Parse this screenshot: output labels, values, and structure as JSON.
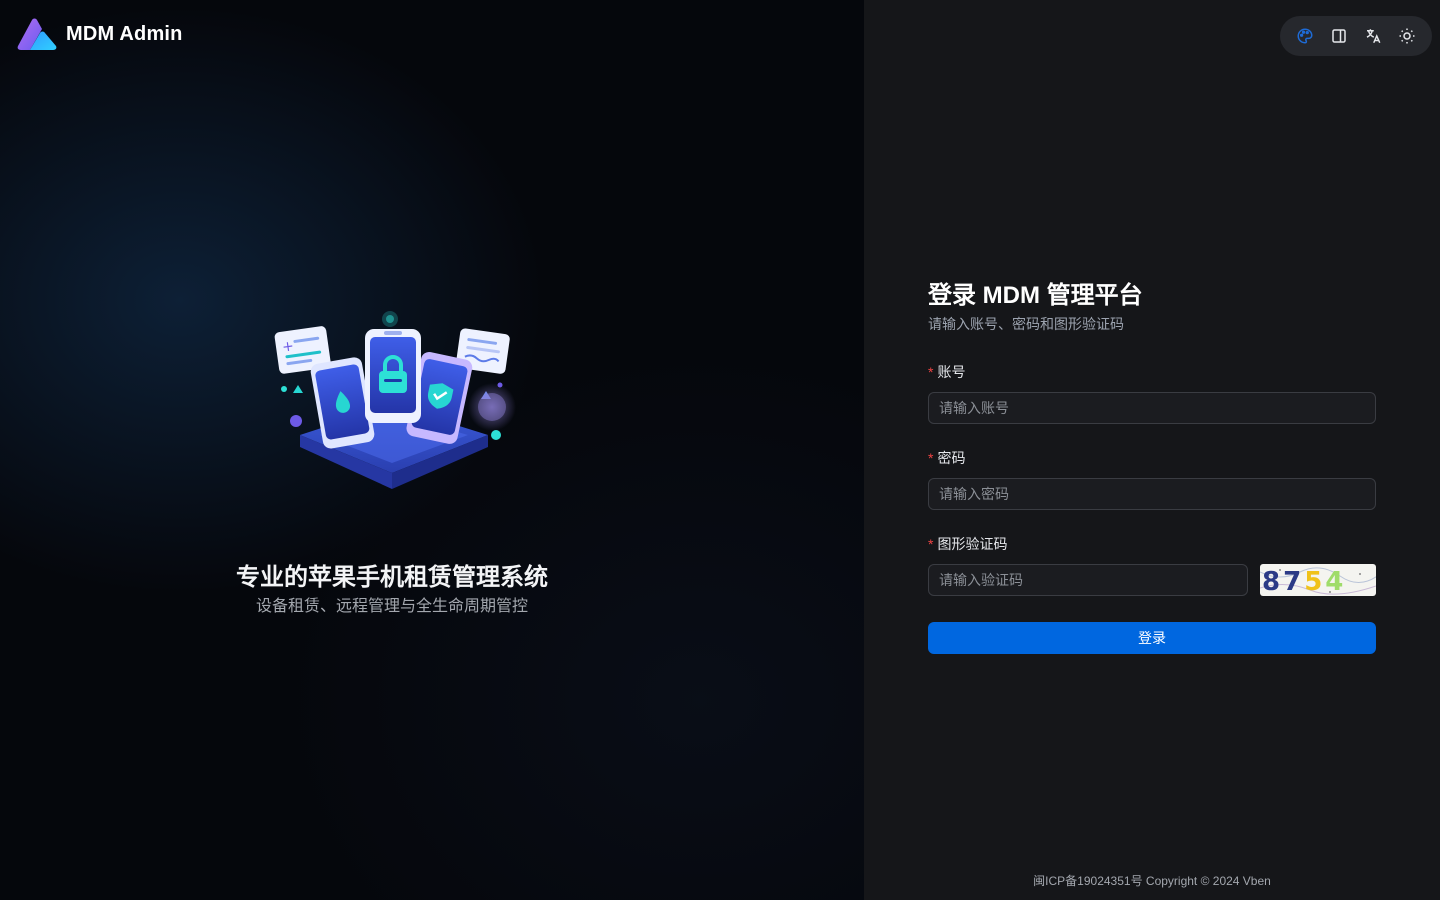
{
  "brand": {
    "name": "MDM Admin"
  },
  "hero": {
    "title": "专业的苹果手机租赁管理系统",
    "subtitle": "设备租赁、远程管理与全生命周期管控"
  },
  "toolbar": {
    "items": [
      {
        "icon": "palette-icon",
        "label": "theme color"
      },
      {
        "icon": "layout-icon",
        "label": "layout"
      },
      {
        "icon": "translate-icon",
        "label": "language"
      },
      {
        "icon": "sun-icon",
        "label": "theme mode"
      }
    ],
    "accent": "#1e6bd6"
  },
  "login": {
    "title": "登录 MDM 管理平台",
    "subtitle": "请输入账号、密码和图形验证码",
    "required_mark": "*",
    "account": {
      "label": "账号",
      "placeholder": "请输入账号",
      "value": ""
    },
    "password": {
      "label": "密码",
      "placeholder": "请输入密码",
      "value": ""
    },
    "captcha": {
      "label": "图形验证码",
      "placeholder": "请输入验证码",
      "value": "",
      "image_text": "8754"
    },
    "submit_label": "登录"
  },
  "footer": {
    "text": "闽ICP备19024351号 Copyright © 2024 Vben"
  },
  "colors": {
    "primary": "#0067e0",
    "required": "#ef4444",
    "panel": "#151619"
  }
}
